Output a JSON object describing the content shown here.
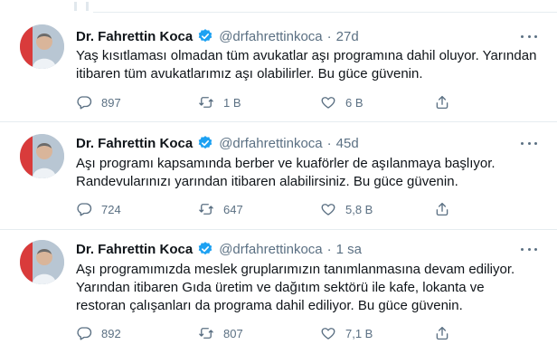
{
  "colors": {
    "verified": "#1da1f2",
    "muted": "#5b7083",
    "divider": "#e6ecf0",
    "text": "#0f1419"
  },
  "icons": {
    "reply": "speech-bubble-icon",
    "retweet": "retweet-icon",
    "like": "heart-icon",
    "share": "share-icon",
    "more": "more-dots-icon",
    "verified": "verified-badge-icon"
  },
  "tweets": [
    {
      "name": "Dr. Fahrettin Koca",
      "handle": "@drfahrettinkoca",
      "separator": "·",
      "time": "27d",
      "lines": [
        "Yaş kısıtlaması olmadan tüm avukatlar aşı programına dahil oluyor. Yarından",
        "itibaren tüm avukatlarımız aşı olabilirler. Bu güce güvenin."
      ],
      "replies": "897",
      "retweets": "1 B",
      "likes": "6 B"
    },
    {
      "name": "Dr. Fahrettin Koca",
      "handle": "@drfahrettinkoca",
      "separator": "·",
      "time": "45d",
      "lines": [
        "Aşı programı kapsamında berber ve kuaförler de aşılanmaya başlıyor.",
        "Randevularınızı yarından itibaren alabilirsiniz. Bu güce güvenin."
      ],
      "replies": "724",
      "retweets": "647",
      "likes": "5,8 B"
    },
    {
      "name": "Dr. Fahrettin Koca",
      "handle": "@drfahrettinkoca",
      "separator": "·",
      "time": "1 sa",
      "lines": [
        "Aşı programımızda meslek gruplarımızın tanımlanmasına devam ediliyor.",
        "Yarından itibaren Gıda üretim ve dağıtım sektörü ile kafe, lokanta ve",
        "restoran çalışanları da programa dahil ediliyor. Bu güce güvenin."
      ],
      "replies": "892",
      "retweets": "807",
      "likes": "7,1 B"
    }
  ]
}
